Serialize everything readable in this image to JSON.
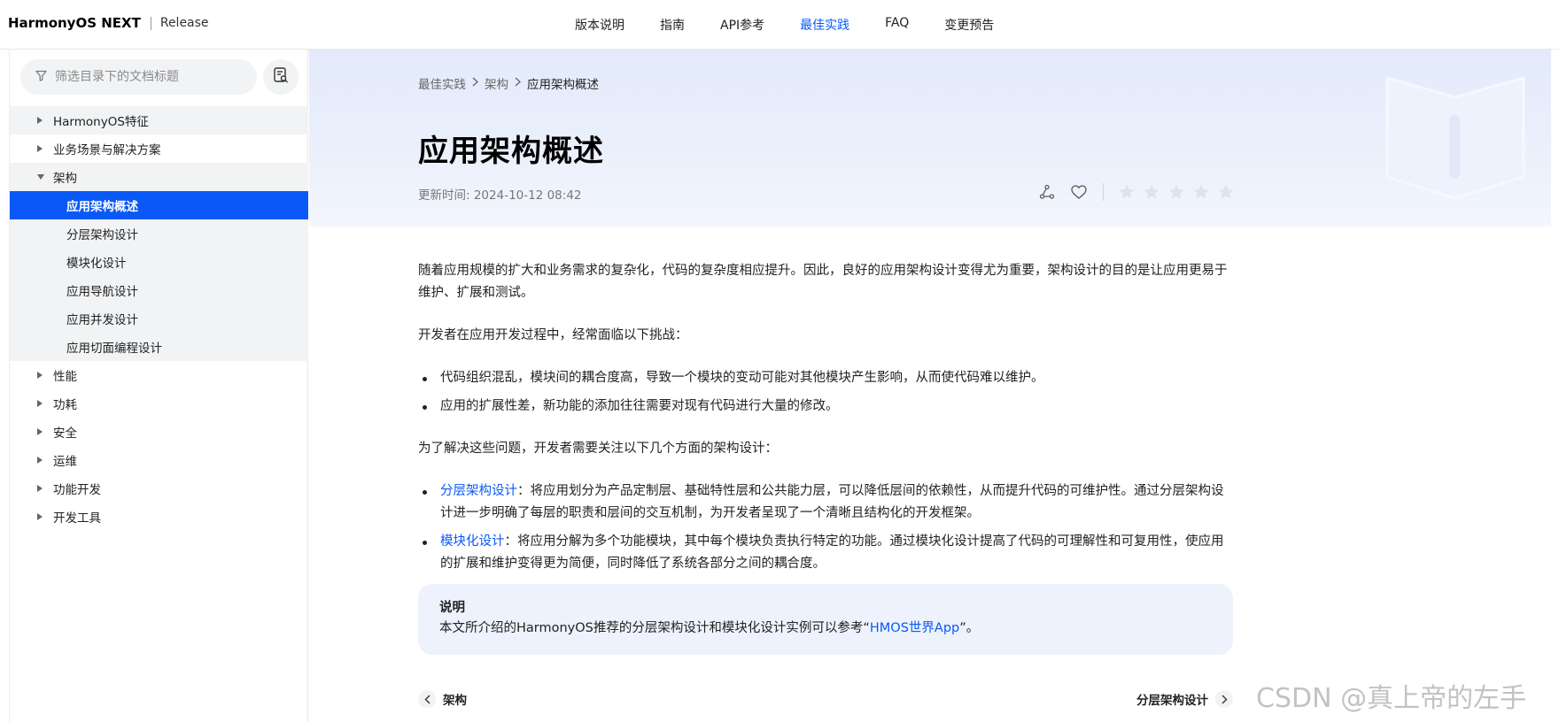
{
  "header": {
    "brand": "HarmonyOS NEXT",
    "release": "Release",
    "nav": [
      {
        "label": "版本说明",
        "active": false
      },
      {
        "label": "指南",
        "active": false
      },
      {
        "label": "API参考",
        "active": false
      },
      {
        "label": "最佳实践",
        "active": true
      },
      {
        "label": "FAQ",
        "active": false
      },
      {
        "label": "变更预告",
        "active": false
      }
    ]
  },
  "sidebar": {
    "filter_placeholder": "筛选目录下的文档标题",
    "filter_icon": "filter-icon",
    "doc_button_icon": "doc-search-icon",
    "items": [
      {
        "label": "HarmonyOS特征",
        "level": 1,
        "state": "collapsed"
      },
      {
        "label": "业务场景与解决方案",
        "level": 1,
        "state": "collapsed"
      },
      {
        "label": "架构",
        "level": 1,
        "state": "expanded"
      },
      {
        "label": "应用架构概述",
        "level": 2,
        "state": "selected"
      },
      {
        "label": "分层架构设计",
        "level": 2,
        "state": "leaf"
      },
      {
        "label": "模块化设计",
        "level": 2,
        "state": "leaf"
      },
      {
        "label": "应用导航设计",
        "level": 2,
        "state": "leaf"
      },
      {
        "label": "应用并发设计",
        "level": 2,
        "state": "leaf"
      },
      {
        "label": "应用切面编程设计",
        "level": 2,
        "state": "leaf"
      },
      {
        "label": "性能",
        "level": 1,
        "state": "collapsed"
      },
      {
        "label": "功耗",
        "level": 1,
        "state": "collapsed"
      },
      {
        "label": "安全",
        "level": 1,
        "state": "collapsed"
      },
      {
        "label": "运维",
        "level": 1,
        "state": "collapsed"
      },
      {
        "label": "功能开发",
        "level": 1,
        "state": "collapsed"
      },
      {
        "label": "开发工具",
        "level": 1,
        "state": "collapsed"
      }
    ]
  },
  "article": {
    "breadcrumb": [
      "最佳实践",
      "架构",
      "应用架构概述"
    ],
    "title": "应用架构概述",
    "updated": "更新时间: 2024-10-12 08:42",
    "actions": [
      "share-icon",
      "favorite-heart-icon"
    ],
    "rating": {
      "max": 5,
      "value": 0
    },
    "p1": "随着应用规模的扩大和业务需求的复杂化，代码的复杂度相应提升。因此，良好的应用架构设计变得尤为重要，架构设计的目的是让应用更易于维护、扩展和测试。",
    "p2": "开发者在应用开发过程中，经常面临以下挑战：",
    "challenges": [
      "代码组织混乱，模块间的耦合度高，导致一个模块的变动可能对其他模块产生影响，从而使代码难以维护。",
      "应用的扩展性差，新功能的添加往往需要对现有代码进行大量的修改。"
    ],
    "p3": "为了解决这些问题，开发者需要关注以下几个方面的架构设计：",
    "designs": [
      {
        "link": "分层架构设计",
        "text": "：将应用划分为产品定制层、基础特性层和公共能力层，可以降低层间的依赖性，从而提升代码的可维护性。通过分层架构设计进一步明确了每层的职责和层间的交互机制，为开发者呈现了一个清晰且结构化的开发框架。"
      },
      {
        "link": "模块化设计",
        "text": "：将应用分解为多个功能模块，其中每个模块负责执行特定的功能。通过模块化设计提高了代码的可理解性和可复用性，使应用的扩展和维护变得更为简便，同时降低了系统各部分之间的耦合度。"
      }
    ],
    "note": {
      "title": "说明",
      "text_before": "本文所介绍的HarmonyOS推荐的分层架构设计和模块化设计实例可以参考“",
      "link": "HMOS世界App",
      "text_after": "”。"
    },
    "prev": "架构",
    "next": "分层架构设计"
  },
  "watermark": "CSDN @真上帝的左手",
  "colors": {
    "accent": "#0a59f7",
    "hero_bg": "#e6ecfb",
    "sidebar_group_bg": "#f1f3f5"
  }
}
